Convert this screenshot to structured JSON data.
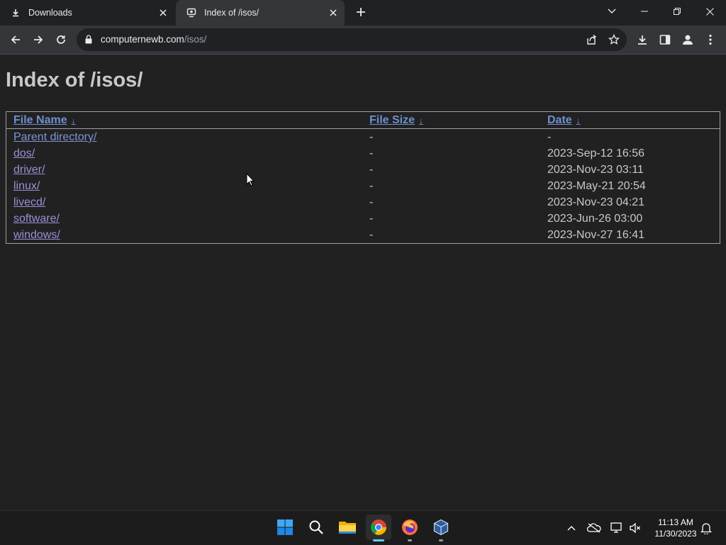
{
  "browser": {
    "tabs": [
      {
        "title": "Downloads",
        "icon": "download-icon",
        "active": false
      },
      {
        "title": "Index of /isos/",
        "icon": "site-favicon-icon",
        "active": true
      }
    ],
    "address": {
      "domain": "computernewb.com",
      "path": "/isos/"
    }
  },
  "page": {
    "title": "Index of /isos/",
    "columns": [
      {
        "label": "File Name",
        "sort": "↓"
      },
      {
        "label": "File Size",
        "sort": "↓"
      },
      {
        "label": "Date",
        "sort": "↓"
      }
    ],
    "rows": [
      {
        "name": "Parent directory/",
        "size": "-",
        "date": "-"
      },
      {
        "name": "dos/",
        "size": "-",
        "date": "2023-Sep-12 16:56"
      },
      {
        "name": "driver/",
        "size": "-",
        "date": "2023-Nov-23 03:11"
      },
      {
        "name": "linux/",
        "size": "-",
        "date": "2023-May-21 20:54"
      },
      {
        "name": "livecd/",
        "size": "-",
        "date": "2023-Nov-23 04:21"
      },
      {
        "name": "software/",
        "size": "-",
        "date": "2023-Jun-26 03:00"
      },
      {
        "name": "windows/",
        "size": "-",
        "date": "2023-Nov-27 16:41"
      }
    ]
  },
  "taskbar": {
    "apps": [
      "start-icon",
      "search-icon",
      "file-explorer-icon",
      "chrome-icon",
      "firefox-icon",
      "virtualbox-icon"
    ],
    "time": "11:13 AM",
    "date": "11/30/2023"
  },
  "colors": {
    "page_bg": "#212121",
    "link": "#9b8fd8",
    "header_link": "#6f8fd0"
  }
}
